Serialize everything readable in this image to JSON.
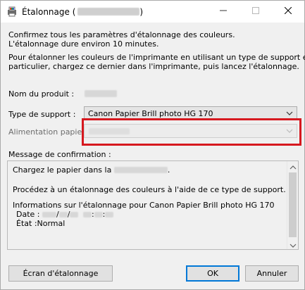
{
  "window": {
    "title": "Étalonnage",
    "title_paren_open": "(",
    "title_paren_close": ")",
    "app_icon": "printer-calibration-icon",
    "controls": {
      "minimize_icon": "minimize-icon",
      "maximize_icon": "maximize-icon",
      "close_icon": "close-icon"
    }
  },
  "intro": {
    "line1": "Confirmez tous les paramètres d'étalonnage des couleurs.",
    "line2": "L'étalonnage dure environ 10 minutes.",
    "line3": "Pour étalonner les couleurs de l'imprimante en utilisant un type de support en",
    "line4": "particulier, chargez ce dernier dans l'imprimante, puis lancez l'étalonnage."
  },
  "form": {
    "product_label": "Nom du produit :",
    "media_type_label": "Type de support :",
    "media_type_value": "Canon Papier Brill photo HG 170",
    "paper_source_label": "Alimentation papier :",
    "message_label": "Message de confirmation :"
  },
  "message": {
    "line1_prefix": "Chargez le papier dans la",
    "line1_suffix": ".",
    "line2": "Procédez à un étalonnage des couleurs à l'aide de ce type de support.",
    "line3": "Informations sur l'étalonnage pour Canon Papier Brill photo HG 170",
    "date_label": "Date :",
    "date_sep1": "/",
    "date_sep2": "/",
    "time_sep1": ":",
    "time_sep2": ":",
    "status_line": "État :Normal"
  },
  "buttons": {
    "calibration_screen": "Écran d'étalonnage",
    "ok": "OK",
    "cancel": "Annuler"
  },
  "colors": {
    "highlight": "#d6181f",
    "default_button_border": "#0078d7"
  }
}
